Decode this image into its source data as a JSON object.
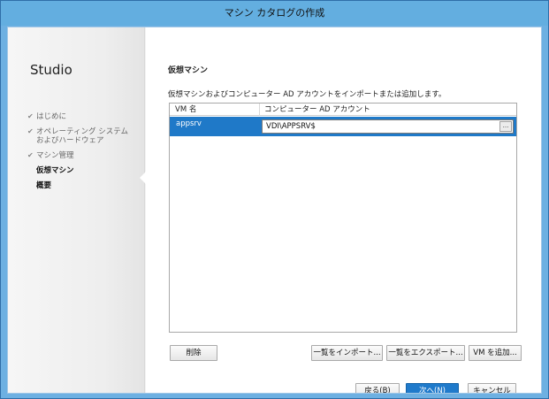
{
  "window": {
    "title": "マシン カタログの作成"
  },
  "sidebar": {
    "brand": "Studio",
    "steps": [
      {
        "label": "はじめに",
        "completed": true
      },
      {
        "label": "オペレーティング システム",
        "label2": "およびハードウェア",
        "completed": true
      },
      {
        "label": "マシン管理",
        "completed": true
      },
      {
        "label": "仮想マシン",
        "current": true
      },
      {
        "label": "概要"
      }
    ]
  },
  "main": {
    "title": "仮想マシン",
    "description": "仮想マシンおよびコンピューター AD アカウントをインポートまたは追加します。",
    "grid": {
      "columns": [
        "VM 名",
        "コンピューター AD アカウント"
      ],
      "rows": [
        {
          "vm_name": "appsrv",
          "ad_account": "VDI\\APPSRV$",
          "browse": "..."
        }
      ]
    },
    "actions": {
      "remove": "削除",
      "import": "一覧をインポート...",
      "export": "一覧をエクスポート...",
      "add_vm": "VM を追加..."
    },
    "nav": {
      "back": "戻る(B)",
      "next": "次へ(N)",
      "cancel": "キャンセル"
    }
  },
  "colors": {
    "title_bar": "#63aee0",
    "selection": "#1f79c8",
    "primary_button": "#1f7acb"
  }
}
